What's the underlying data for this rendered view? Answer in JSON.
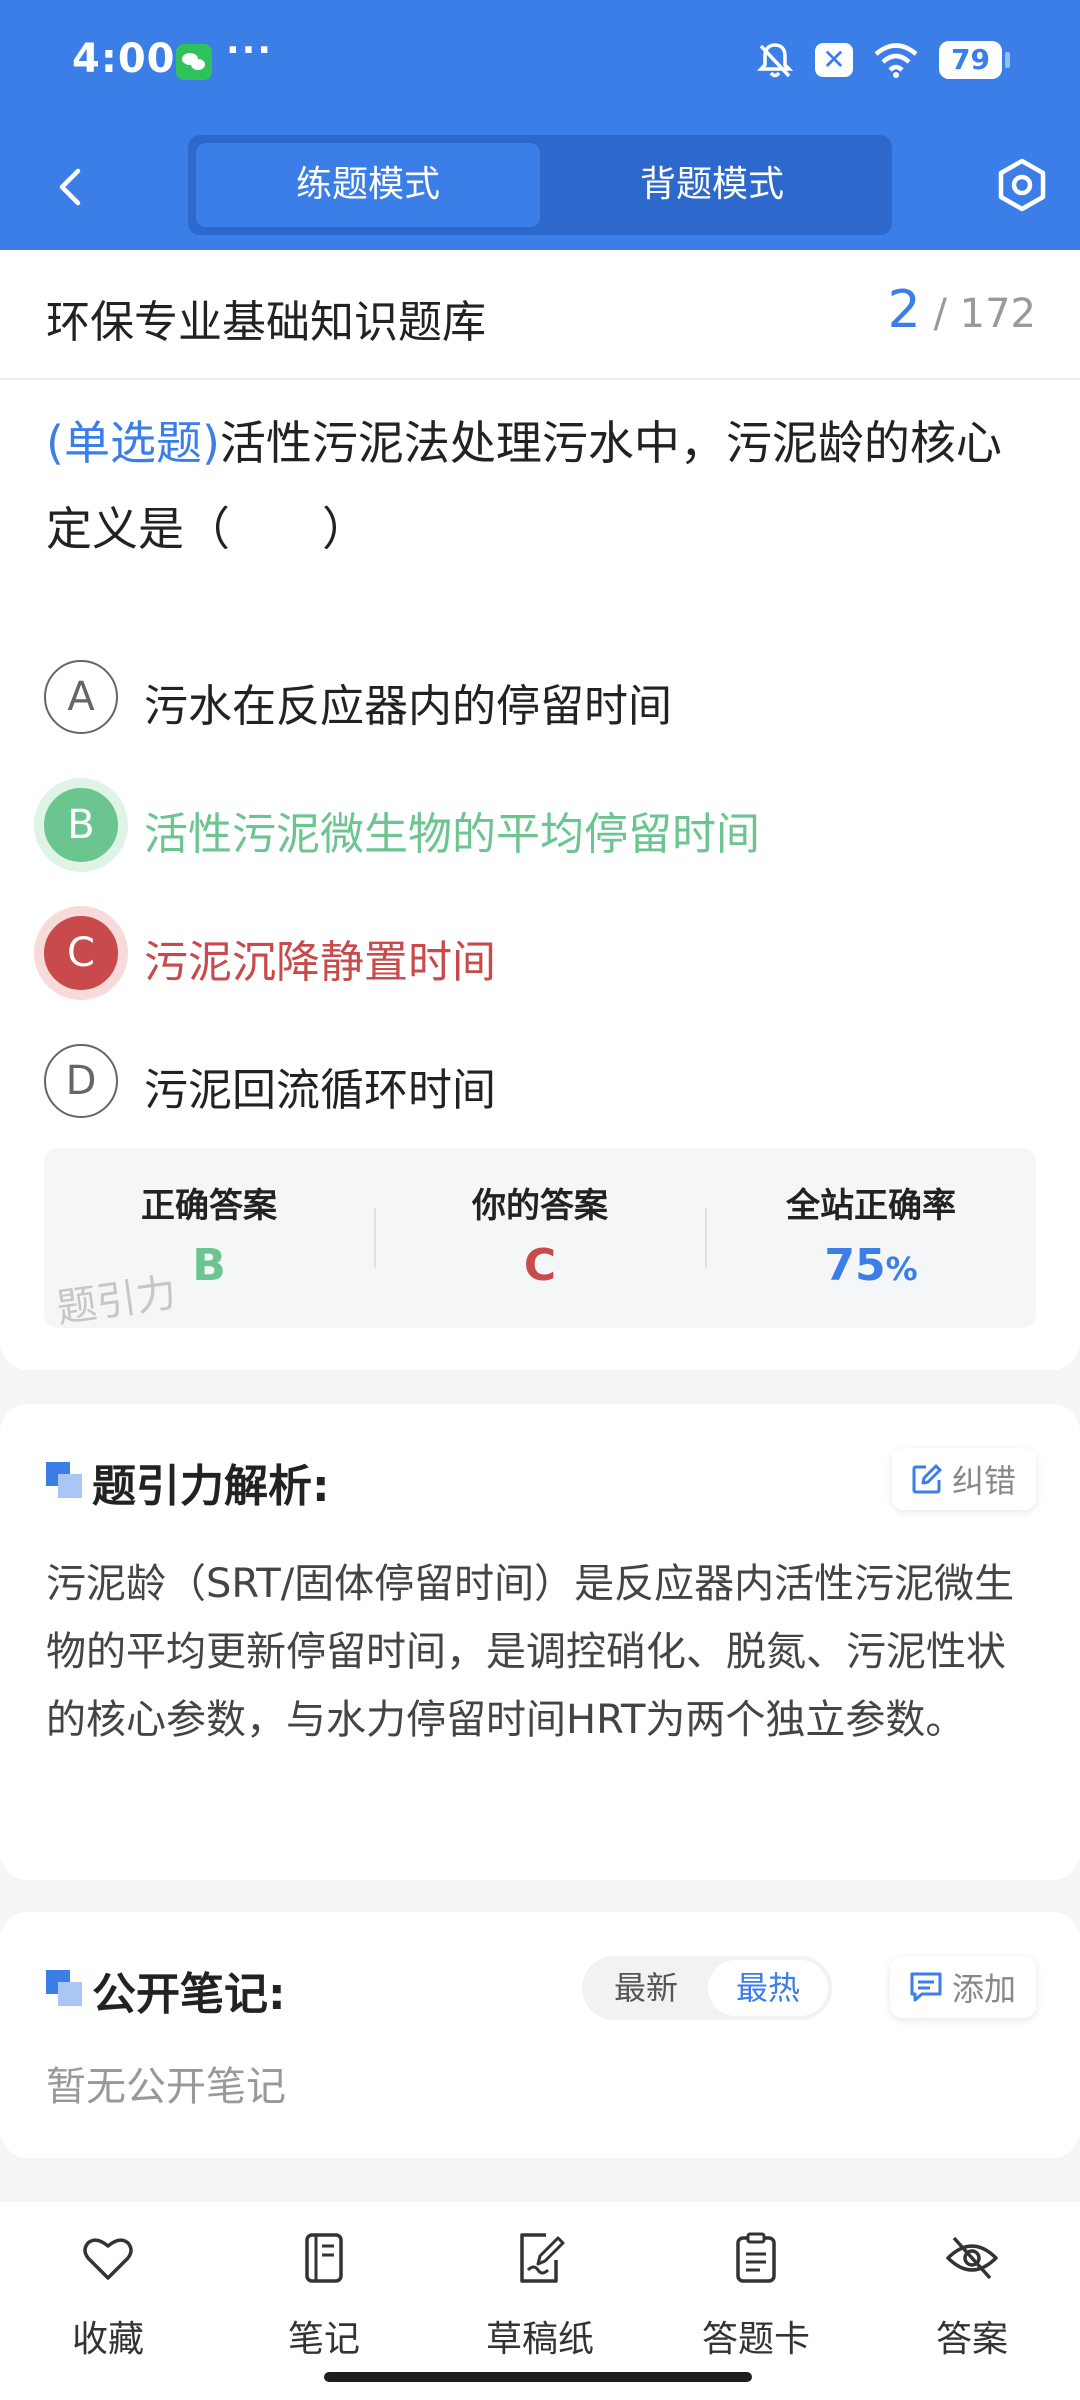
{
  "status_bar": {
    "time": "4:00",
    "dots": "···",
    "battery": "79"
  },
  "nav": {
    "tab_practice": "练题模式",
    "tab_memorize": "背题模式"
  },
  "bank": {
    "title": "环保专业基础知识题库",
    "current": "2",
    "separator": "/",
    "total": "172"
  },
  "question": {
    "type": "(单选题)",
    "text": "活性污泥法处理污水中，污泥龄的核心定义是（　　）",
    "options": [
      {
        "letter": "A",
        "text": "污水在反应器内的停留时间"
      },
      {
        "letter": "B",
        "text": "活性污泥微生物的平均停留时间"
      },
      {
        "letter": "C",
        "text": "污泥沉降静置时间"
      },
      {
        "letter": "D",
        "text": "污泥回流循环时间"
      }
    ]
  },
  "stats": {
    "correct_label": "正确答案",
    "correct_value": "B",
    "yours_label": "你的答案",
    "yours_value": "C",
    "rate_label": "全站正确率",
    "rate_value": "75",
    "rate_unit": "%",
    "watermark": "题引力"
  },
  "analysis": {
    "title": "题引力解析:",
    "correct_btn": "纠错",
    "text": "污泥龄（SRT/固体停留时间）是反应器内活性污泥微生物的平均更新停留时间，是调控硝化、脱氮、污泥性状的核心参数，与水力停留时间HRT为两个独立参数。"
  },
  "notes": {
    "title": "公开笔记:",
    "sort_latest": "最新",
    "sort_hot": "最热",
    "add_btn": "添加",
    "empty": "暂无公开笔记"
  },
  "bottom_bar": [
    {
      "label": "收藏",
      "icon": "heart-icon"
    },
    {
      "label": "笔记",
      "icon": "notebook-icon"
    },
    {
      "label": "草稿纸",
      "icon": "draft-paper-icon"
    },
    {
      "label": "答题卡",
      "icon": "answer-sheet-icon"
    },
    {
      "label": "答案",
      "icon": "eye-off-icon"
    }
  ],
  "colors": {
    "primary": "#3b7ee8",
    "correct": "#6ac58f",
    "wrong": "#c94a4a"
  }
}
